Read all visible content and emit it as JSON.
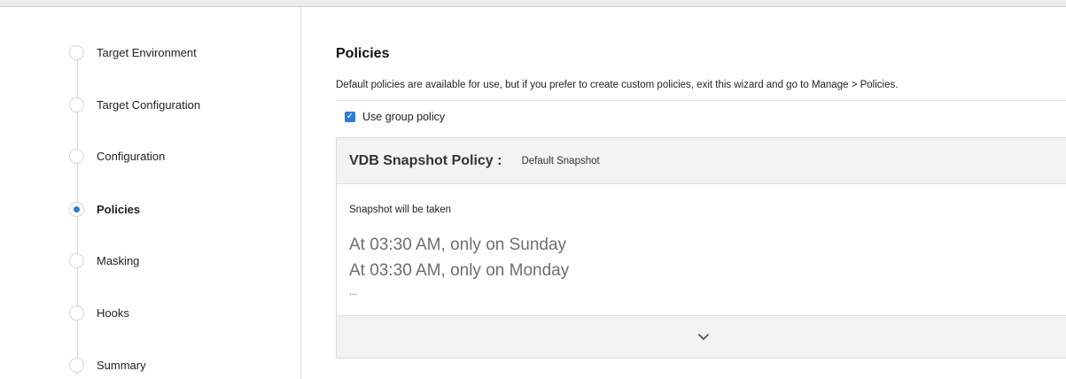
{
  "steps": [
    {
      "label": "Target Environment",
      "active": false
    },
    {
      "label": "Target Configuration",
      "active": false
    },
    {
      "label": "Configuration",
      "active": false
    },
    {
      "label": "Policies",
      "active": true
    },
    {
      "label": "Masking",
      "active": false
    },
    {
      "label": "Hooks",
      "active": false
    },
    {
      "label": "Summary",
      "active": false
    }
  ],
  "main": {
    "title": "Policies",
    "description": "Default policies are available for use, but if you prefer to create custom policies, exit this wizard and go to Manage > Policies.",
    "use_group_policy": {
      "label": "Use group policy",
      "checked": true
    }
  },
  "policy_card": {
    "title": "VDB Snapshot Policy :",
    "value": "Default Snapshot",
    "subtitle": "Snapshot will be taken",
    "schedule": [
      "At 03:30 AM, only on Sunday",
      "At 03:30 AM, only on Monday"
    ],
    "more": "...",
    "expand_icon": "chevron-down-icon"
  },
  "colors": {
    "accent": "#2f7bd8",
    "card_bg": "#f3f3f3",
    "border": "#dcdcdc"
  }
}
